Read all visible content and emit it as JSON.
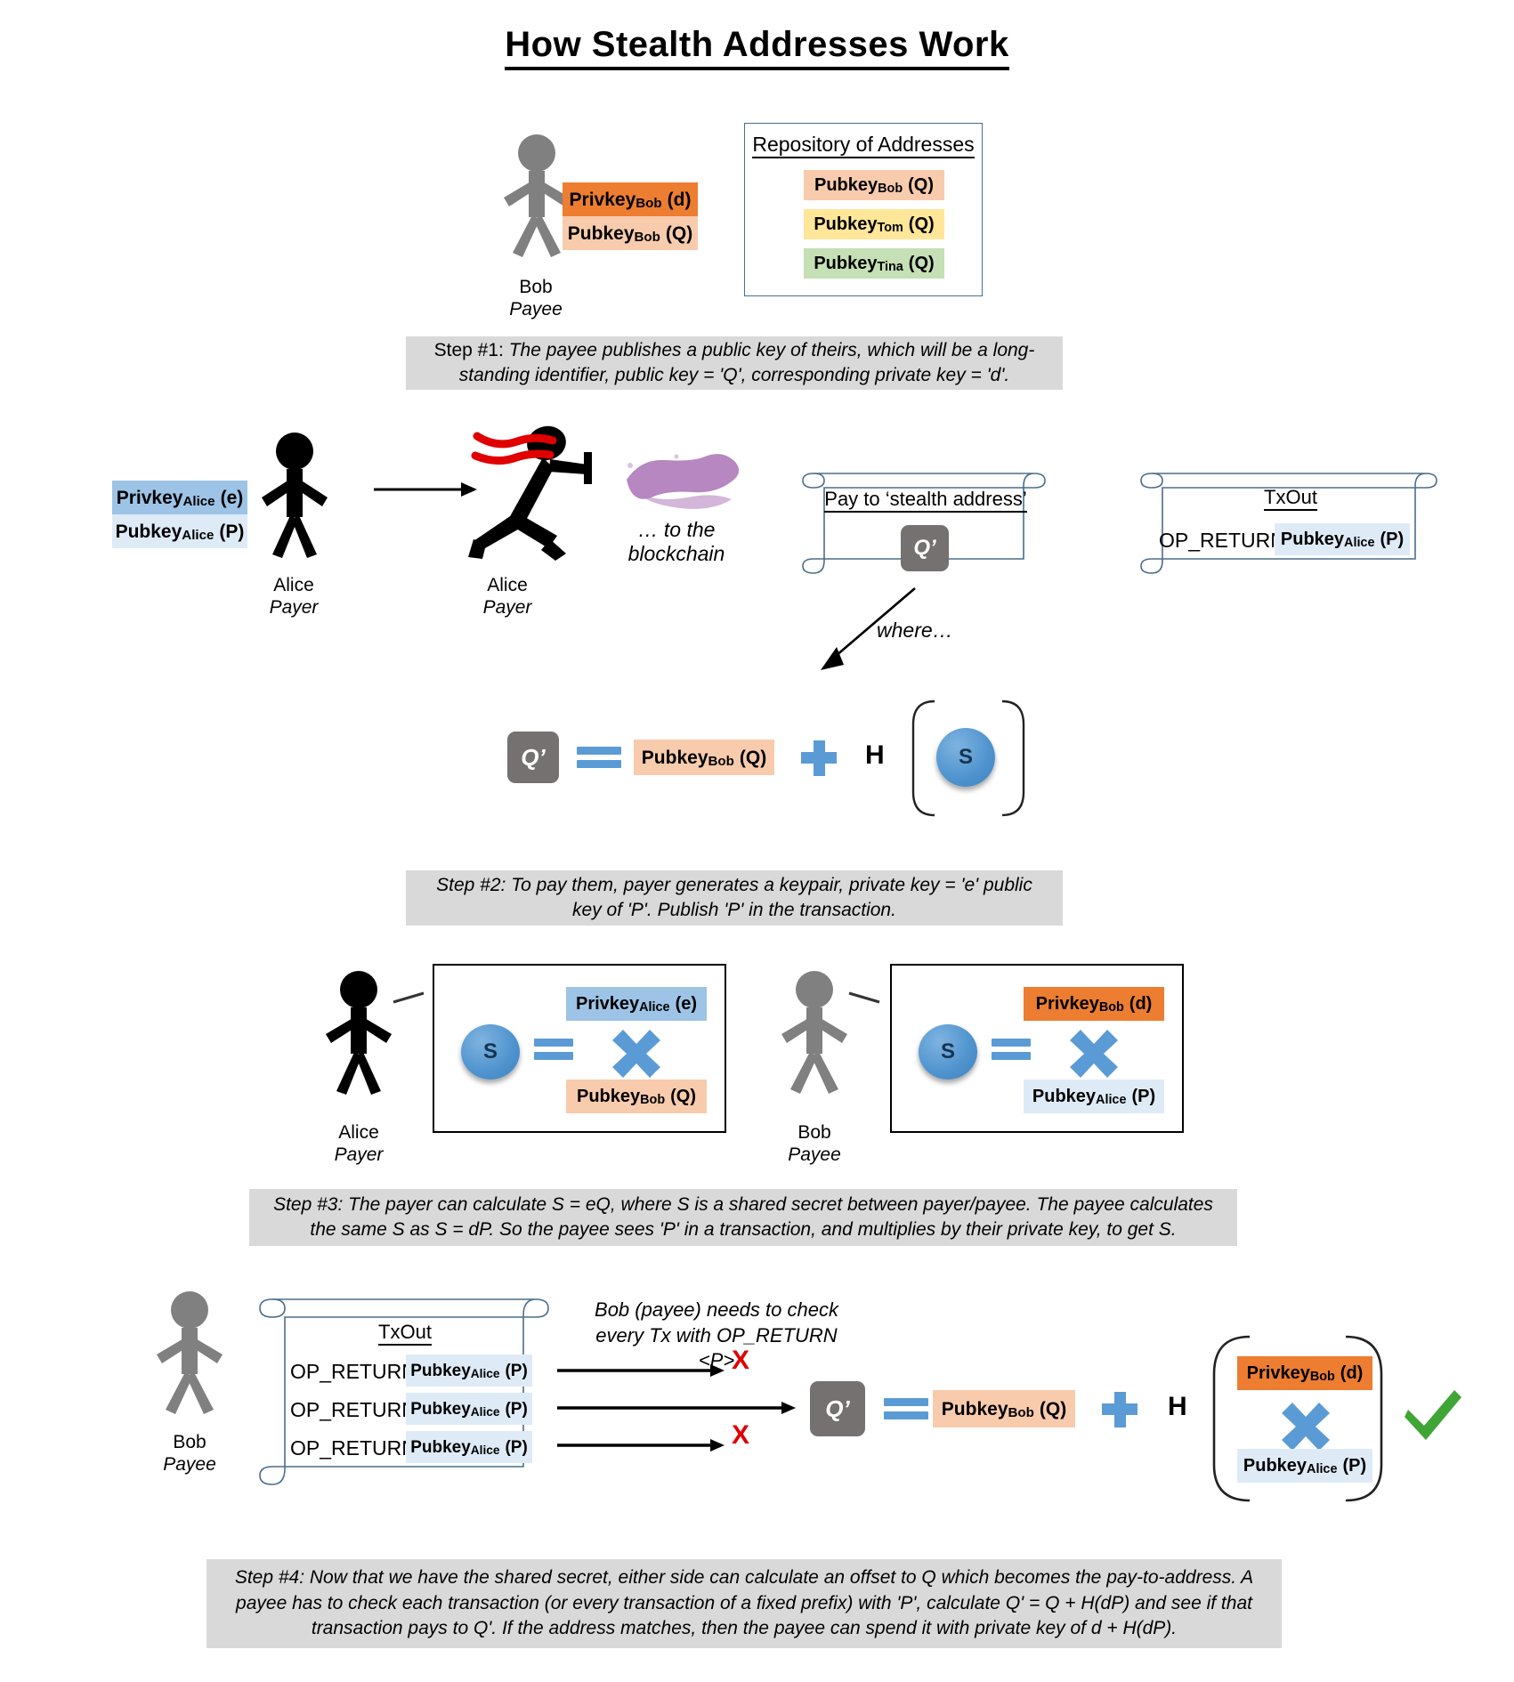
{
  "title": "How Stealth Addresses Work",
  "repository": {
    "heading": "Repository of Addresses",
    "entries": [
      {
        "name": "Pubkey",
        "sub": "Bob",
        "val": "(Q)",
        "color": "#F8CBAD"
      },
      {
        "name": "Pubkey",
        "sub": "Tom",
        "val": "(Q)",
        "color": "#FFE699"
      },
      {
        "name": "Pubkey",
        "sub": "Tina",
        "val": "(Q)",
        "color": "#C5E0B4"
      }
    ]
  },
  "people": {
    "bob_top": {
      "name": "Bob",
      "role": "Payee"
    },
    "alice_left": {
      "name": "Alice",
      "role": "Payer"
    },
    "alice_run": {
      "name": "Alice",
      "role": "Payer"
    },
    "alice_s": {
      "name": "Alice",
      "role": "Payer"
    },
    "bob_s": {
      "name": "Bob",
      "role": "Payee"
    },
    "bob_bottom": {
      "name": "Bob",
      "role": "Payee"
    }
  },
  "keys": {
    "privkey_bob": {
      "name": "Privkey",
      "sub": "Bob",
      "val": "(d)"
    },
    "pubkey_bob": {
      "name": "Pubkey",
      "sub": "Bob",
      "val": "(Q)"
    },
    "privkey_alice": {
      "name": "Privkey",
      "sub": "Alice",
      "val": "(e)"
    },
    "pubkey_alice": {
      "name": "Pubkey",
      "sub": "Alice",
      "val": "(P)"
    }
  },
  "blockchain_note": "… to the blockchain",
  "stealth_scroll": {
    "heading": "Pay to ‘stealth address’",
    "qprime": "Q’"
  },
  "txout_top": {
    "heading": "TxOut",
    "op_return": "OP_RETURN"
  },
  "where_label": "where…",
  "equation_where": {
    "qprime": "Q’",
    "plus": "+",
    "h": "H",
    "s": "S"
  },
  "shared_secret": {
    "alice_s": "S",
    "bob_s": "S"
  },
  "txout_bottom": {
    "heading": "TxOut",
    "rows": [
      {
        "op_return": "OP_RETURN",
        "match": false
      },
      {
        "op_return": "OP_RETURN",
        "match": true
      },
      {
        "op_return": "OP_RETURN",
        "match": false
      }
    ],
    "reject_mark": "X",
    "accept_mark": "✔"
  },
  "bob_check_note": "Bob (payee) needs to check\nevery Tx with OP_RETURN <P>",
  "equation_bottom": {
    "qprime": "Q’",
    "plus": "+",
    "h": "H"
  },
  "steps": {
    "step1_prefix": "Step #1: ",
    "step1": "The payee publishes a public key of theirs, which will be a long-standing identifier, public key = 'Q', corresponding private key = 'd'.",
    "step2_prefix": "Step #2: ",
    "step2": "To pay them, payer generates a keypair, private key = 'e' public key of 'P'. Publish 'P' in the transaction.",
    "step3_prefix": "Step #3: ",
    "step3": "The payer can calculate S = eQ, where S is a shared secret between payer/payee. The payee calculates the same S as S = dP. So the payee sees 'P' in a transaction, and multiplies by their private key, to get S.",
    "step4_prefix": "Step #4: ",
    "step4": "Now that we have the shared secret, either side can calculate an offset to Q which becomes the pay-to-address. A payee has to check each transaction (or every transaction of a fixed prefix) with 'P', calculate Q' = Q + H(dP) and see if that transaction pays to Q'. If the address matches, then the payee can spend it with private key of d + H(dP)."
  },
  "colors": {
    "privkey_bob_bg": "#ED7D31",
    "pubkey_bob_bg": "#F8CBAD",
    "privkey_alice_bg": "#9DC3E6",
    "pubkey_alice_bg": "#DEEBF7",
    "pubkey_tom_bg": "#FFE699",
    "pubkey_tina_bg": "#C5E0B4",
    "caption_bg": "#D9D9D9",
    "qprime_bg": "#767171",
    "accent_blue": "#5B9BD5",
    "reject_red": "#E00000",
    "accept_green": "#3FA535",
    "scroll_stroke": "#4A6E8A",
    "blob_purple": "#9B59A8"
  }
}
